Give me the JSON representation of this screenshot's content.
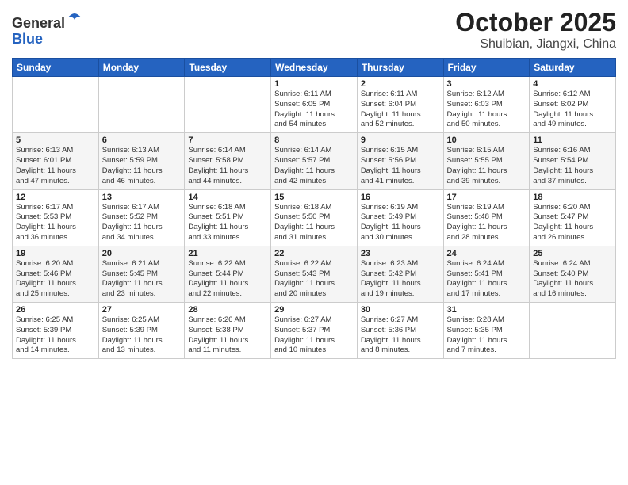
{
  "logo": {
    "general": "General",
    "blue": "Blue"
  },
  "header": {
    "month": "October 2025",
    "location": "Shuibian, Jiangxi, China"
  },
  "weekdays": [
    "Sunday",
    "Monday",
    "Tuesday",
    "Wednesday",
    "Thursday",
    "Friday",
    "Saturday"
  ],
  "weeks": [
    [
      {
        "day": "",
        "info": ""
      },
      {
        "day": "",
        "info": ""
      },
      {
        "day": "",
        "info": ""
      },
      {
        "day": "1",
        "info": "Sunrise: 6:11 AM\nSunset: 6:05 PM\nDaylight: 11 hours\nand 54 minutes."
      },
      {
        "day": "2",
        "info": "Sunrise: 6:11 AM\nSunset: 6:04 PM\nDaylight: 11 hours\nand 52 minutes."
      },
      {
        "day": "3",
        "info": "Sunrise: 6:12 AM\nSunset: 6:03 PM\nDaylight: 11 hours\nand 50 minutes."
      },
      {
        "day": "4",
        "info": "Sunrise: 6:12 AM\nSunset: 6:02 PM\nDaylight: 11 hours\nand 49 minutes."
      }
    ],
    [
      {
        "day": "5",
        "info": "Sunrise: 6:13 AM\nSunset: 6:01 PM\nDaylight: 11 hours\nand 47 minutes."
      },
      {
        "day": "6",
        "info": "Sunrise: 6:13 AM\nSunset: 5:59 PM\nDaylight: 11 hours\nand 46 minutes."
      },
      {
        "day": "7",
        "info": "Sunrise: 6:14 AM\nSunset: 5:58 PM\nDaylight: 11 hours\nand 44 minutes."
      },
      {
        "day": "8",
        "info": "Sunrise: 6:14 AM\nSunset: 5:57 PM\nDaylight: 11 hours\nand 42 minutes."
      },
      {
        "day": "9",
        "info": "Sunrise: 6:15 AM\nSunset: 5:56 PM\nDaylight: 11 hours\nand 41 minutes."
      },
      {
        "day": "10",
        "info": "Sunrise: 6:15 AM\nSunset: 5:55 PM\nDaylight: 11 hours\nand 39 minutes."
      },
      {
        "day": "11",
        "info": "Sunrise: 6:16 AM\nSunset: 5:54 PM\nDaylight: 11 hours\nand 37 minutes."
      }
    ],
    [
      {
        "day": "12",
        "info": "Sunrise: 6:17 AM\nSunset: 5:53 PM\nDaylight: 11 hours\nand 36 minutes."
      },
      {
        "day": "13",
        "info": "Sunrise: 6:17 AM\nSunset: 5:52 PM\nDaylight: 11 hours\nand 34 minutes."
      },
      {
        "day": "14",
        "info": "Sunrise: 6:18 AM\nSunset: 5:51 PM\nDaylight: 11 hours\nand 33 minutes."
      },
      {
        "day": "15",
        "info": "Sunrise: 6:18 AM\nSunset: 5:50 PM\nDaylight: 11 hours\nand 31 minutes."
      },
      {
        "day": "16",
        "info": "Sunrise: 6:19 AM\nSunset: 5:49 PM\nDaylight: 11 hours\nand 30 minutes."
      },
      {
        "day": "17",
        "info": "Sunrise: 6:19 AM\nSunset: 5:48 PM\nDaylight: 11 hours\nand 28 minutes."
      },
      {
        "day": "18",
        "info": "Sunrise: 6:20 AM\nSunset: 5:47 PM\nDaylight: 11 hours\nand 26 minutes."
      }
    ],
    [
      {
        "day": "19",
        "info": "Sunrise: 6:20 AM\nSunset: 5:46 PM\nDaylight: 11 hours\nand 25 minutes."
      },
      {
        "day": "20",
        "info": "Sunrise: 6:21 AM\nSunset: 5:45 PM\nDaylight: 11 hours\nand 23 minutes."
      },
      {
        "day": "21",
        "info": "Sunrise: 6:22 AM\nSunset: 5:44 PM\nDaylight: 11 hours\nand 22 minutes."
      },
      {
        "day": "22",
        "info": "Sunrise: 6:22 AM\nSunset: 5:43 PM\nDaylight: 11 hours\nand 20 minutes."
      },
      {
        "day": "23",
        "info": "Sunrise: 6:23 AM\nSunset: 5:42 PM\nDaylight: 11 hours\nand 19 minutes."
      },
      {
        "day": "24",
        "info": "Sunrise: 6:24 AM\nSunset: 5:41 PM\nDaylight: 11 hours\nand 17 minutes."
      },
      {
        "day": "25",
        "info": "Sunrise: 6:24 AM\nSunset: 5:40 PM\nDaylight: 11 hours\nand 16 minutes."
      }
    ],
    [
      {
        "day": "26",
        "info": "Sunrise: 6:25 AM\nSunset: 5:39 PM\nDaylight: 11 hours\nand 14 minutes."
      },
      {
        "day": "27",
        "info": "Sunrise: 6:25 AM\nSunset: 5:39 PM\nDaylight: 11 hours\nand 13 minutes."
      },
      {
        "day": "28",
        "info": "Sunrise: 6:26 AM\nSunset: 5:38 PM\nDaylight: 11 hours\nand 11 minutes."
      },
      {
        "day": "29",
        "info": "Sunrise: 6:27 AM\nSunset: 5:37 PM\nDaylight: 11 hours\nand 10 minutes."
      },
      {
        "day": "30",
        "info": "Sunrise: 6:27 AM\nSunset: 5:36 PM\nDaylight: 11 hours\nand 8 minutes."
      },
      {
        "day": "31",
        "info": "Sunrise: 6:28 AM\nSunset: 5:35 PM\nDaylight: 11 hours\nand 7 minutes."
      },
      {
        "day": "",
        "info": ""
      }
    ]
  ]
}
